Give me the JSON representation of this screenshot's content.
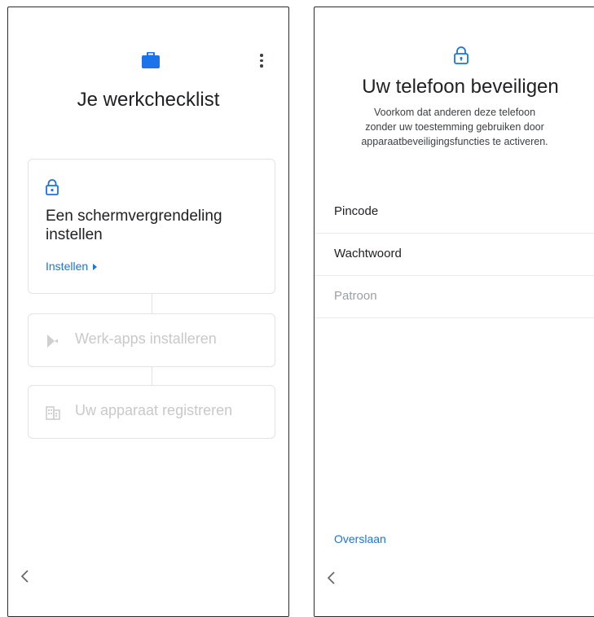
{
  "left_screen": {
    "title": "Je werkchecklist",
    "steps": [
      {
        "icon": "lock-icon",
        "title": "Een schermvergrendeling instellen",
        "action": "Instellen",
        "enabled": true
      },
      {
        "icon": "play-store-icon",
        "title": "Werk-apps installeren",
        "enabled": false
      },
      {
        "icon": "building-icon",
        "title": "Uw apparaat registreren",
        "enabled": false
      }
    ]
  },
  "right_screen": {
    "title": "Uw telefoon beveiligen",
    "subtitle_lines": [
      "Voorkom dat anderen deze telefoon",
      "zonder uw toestemming gebruiken door",
      "apparaatbeveiligingsfuncties te activeren."
    ],
    "options": [
      {
        "label": "Pincode",
        "enabled": true
      },
      {
        "label": "Wachtwoord",
        "enabled": true
      },
      {
        "label": "Patroon",
        "enabled": false
      }
    ],
    "skip_label": "Overslaan"
  },
  "colors": {
    "accent": "#1a73e8",
    "text": "#202124",
    "disabled": "#c9c9c9"
  }
}
